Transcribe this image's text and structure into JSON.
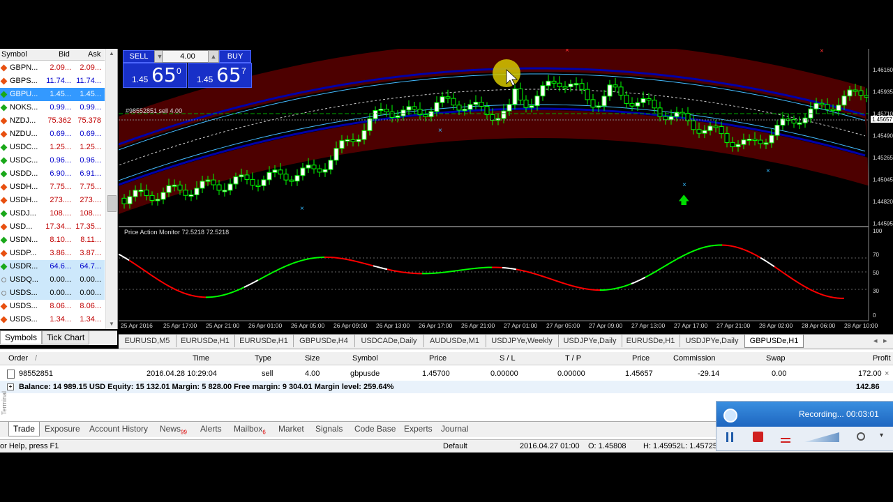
{
  "market_watch": {
    "headers": {
      "symbol": "Symbol",
      "bid": "Bid",
      "ask": "Ask"
    },
    "rows": [
      {
        "symbol": "GBPN...",
        "bid": "2.09...",
        "ask": "2.09...",
        "dir": "down",
        "state": "normal",
        "tone": "red"
      },
      {
        "symbol": "GBPS...",
        "bid": "11.74...",
        "ask": "11.74...",
        "dir": "down",
        "state": "normal",
        "tone": "blue"
      },
      {
        "symbol": "GBPU...",
        "bid": "1.45...",
        "ask": "1.45...",
        "dir": "up",
        "state": "selected",
        "tone": "blue"
      },
      {
        "symbol": "NOKS...",
        "bid": "0.99...",
        "ask": "0.99...",
        "dir": "up",
        "state": "normal",
        "tone": "blue"
      },
      {
        "symbol": "NZDJ...",
        "bid": "75.362",
        "ask": "75.378",
        "dir": "down",
        "state": "normal",
        "tone": "red"
      },
      {
        "symbol": "NZDU...",
        "bid": "0.69...",
        "ask": "0.69...",
        "dir": "down",
        "state": "normal",
        "tone": "blue"
      },
      {
        "symbol": "USDC...",
        "bid": "1.25...",
        "ask": "1.25...",
        "dir": "up",
        "state": "normal",
        "tone": "red"
      },
      {
        "symbol": "USDC...",
        "bid": "0.96...",
        "ask": "0.96...",
        "dir": "up",
        "state": "normal",
        "tone": "blue"
      },
      {
        "symbol": "USDD...",
        "bid": "6.90...",
        "ask": "6.91...",
        "dir": "up",
        "state": "normal",
        "tone": "blue"
      },
      {
        "symbol": "USDH...",
        "bid": "7.75...",
        "ask": "7.75...",
        "dir": "down",
        "state": "normal",
        "tone": "red"
      },
      {
        "symbol": "USDH...",
        "bid": "273....",
        "ask": "273....",
        "dir": "down",
        "state": "normal",
        "tone": "red"
      },
      {
        "symbol": "USDJ...",
        "bid": "108....",
        "ask": "108....",
        "dir": "up",
        "state": "normal",
        "tone": "red"
      },
      {
        "symbol": "USD...",
        "bid": "17.34...",
        "ask": "17.35...",
        "dir": "down",
        "state": "normal",
        "tone": "red"
      },
      {
        "symbol": "USDN...",
        "bid": "8.10...",
        "ask": "8.11...",
        "dir": "up",
        "state": "normal",
        "tone": "red"
      },
      {
        "symbol": "USDP...",
        "bid": "3.86...",
        "ask": "3.87...",
        "dir": "down",
        "state": "normal",
        "tone": "red"
      },
      {
        "symbol": "USDR...",
        "bid": "64.6...",
        "ask": "64.7...",
        "dir": "up",
        "state": "highlight",
        "tone": "blue"
      },
      {
        "symbol": "USDQ...",
        "bid": "0.00...",
        "ask": "0.00...",
        "dir": "none",
        "state": "highlight",
        "tone": "black"
      },
      {
        "symbol": "USDS...",
        "bid": "0.00...",
        "ask": "0.00...",
        "dir": "none",
        "state": "highlight",
        "tone": "black"
      },
      {
        "symbol": "USDS...",
        "bid": "8.06...",
        "ask": "8.06...",
        "dir": "down",
        "state": "normal",
        "tone": "red"
      },
      {
        "symbol": "USDS...",
        "bid": "1.34...",
        "ask": "1.34...",
        "dir": "down",
        "state": "normal",
        "tone": "red"
      }
    ],
    "tabs": [
      "Symbols",
      "Tick Chart"
    ]
  },
  "one_click": {
    "sell_label": "SELL",
    "buy_label": "BUY",
    "lot": "4.00",
    "sell_price_small": "1.45",
    "sell_price_big": "65",
    "sell_price_sup": "0",
    "buy_price_small": "1.45",
    "buy_price_big": "65",
    "buy_price_sup": "7"
  },
  "chart": {
    "order_label": "#98552851 sell 4.00",
    "indicator_label": "Price Action Monitor 72.5218 72.5218",
    "price_axis": [
      "1.46160",
      "1.45935",
      "1.45710",
      "1.45490",
      "1.45265",
      "1.45045",
      "1.44820",
      "1.44595"
    ],
    "current_price": "1.45657",
    "indicator_axis": [
      "100",
      "70",
      "50",
      "30",
      "0"
    ],
    "time_axis": [
      "25 Apr 2016",
      "25 Apr 17:00",
      "25 Apr 21:00",
      "26 Apr 01:00",
      "26 Apr 05:00",
      "26 Apr 09:00",
      "26 Apr 13:00",
      "26 Apr 17:00",
      "26 Apr 21:00",
      "27 Apr 01:00",
      "27 Apr 05:00",
      "27 Apr 09:00",
      "27 Apr 13:00",
      "27 Apr 17:00",
      "27 Apr 21:00",
      "28 Apr 02:00",
      "28 Apr 06:00",
      "28 Apr 10:00"
    ],
    "tabs": [
      "EURUSD,M5",
      "EURUSDe,H1",
      "EURUSDe,H1",
      "GBPUSDe,H4",
      "USDCADe,Daily",
      "AUDUSDe,M1",
      "USDJPYe,Weekly",
      "USDJPYe,Daily",
      "EURUSDe,H1",
      "USDJPYe,Daily",
      "GBPUSDe,H1"
    ],
    "active_tab": 10,
    "colors": {
      "band": "#5a0000",
      "up": "#00ff00",
      "down": "#ff0000",
      "blue_line": "#0000aa",
      "cyan": "#44bbff"
    }
  },
  "terminal": {
    "headers": [
      "Order",
      "/",
      "Time",
      "Type",
      "Size",
      "Symbol",
      "Price",
      "S / L",
      "T / P",
      "Price",
      "Commission",
      "Swap",
      "Profit"
    ],
    "row": [
      "98552851",
      "2016.04.28 10:29:04",
      "sell",
      "4.00",
      "gbpusde",
      "1.45700",
      "0.00000",
      "0.00000",
      "1.45657",
      "-29.14",
      "0.00",
      "172.00"
    ],
    "balance": "Balance: 14 989.15 USD  Equity: 15 132.01  Margin: 5 828.00  Free margin: 9 304.01  Margin level: 259.64%",
    "balance_profit": "142.86",
    "tabs": [
      "Trade",
      "Exposure",
      "Account History",
      "News",
      "Alerts",
      "Mailbox",
      "Market",
      "Signals",
      "Code Base",
      "Experts",
      "Journal"
    ],
    "news_count": "99",
    "mailbox_count": "6",
    "side_label": "Terminal"
  },
  "status": {
    "help": "or Help, press F1",
    "profile": "Default",
    "datetime": "2016.04.27 01:00",
    "open": "O: 1.45808",
    "high": "H: 1.45952",
    "low": "L: 1.45725"
  },
  "recorder": {
    "label": "Recording... 00:03:01"
  }
}
